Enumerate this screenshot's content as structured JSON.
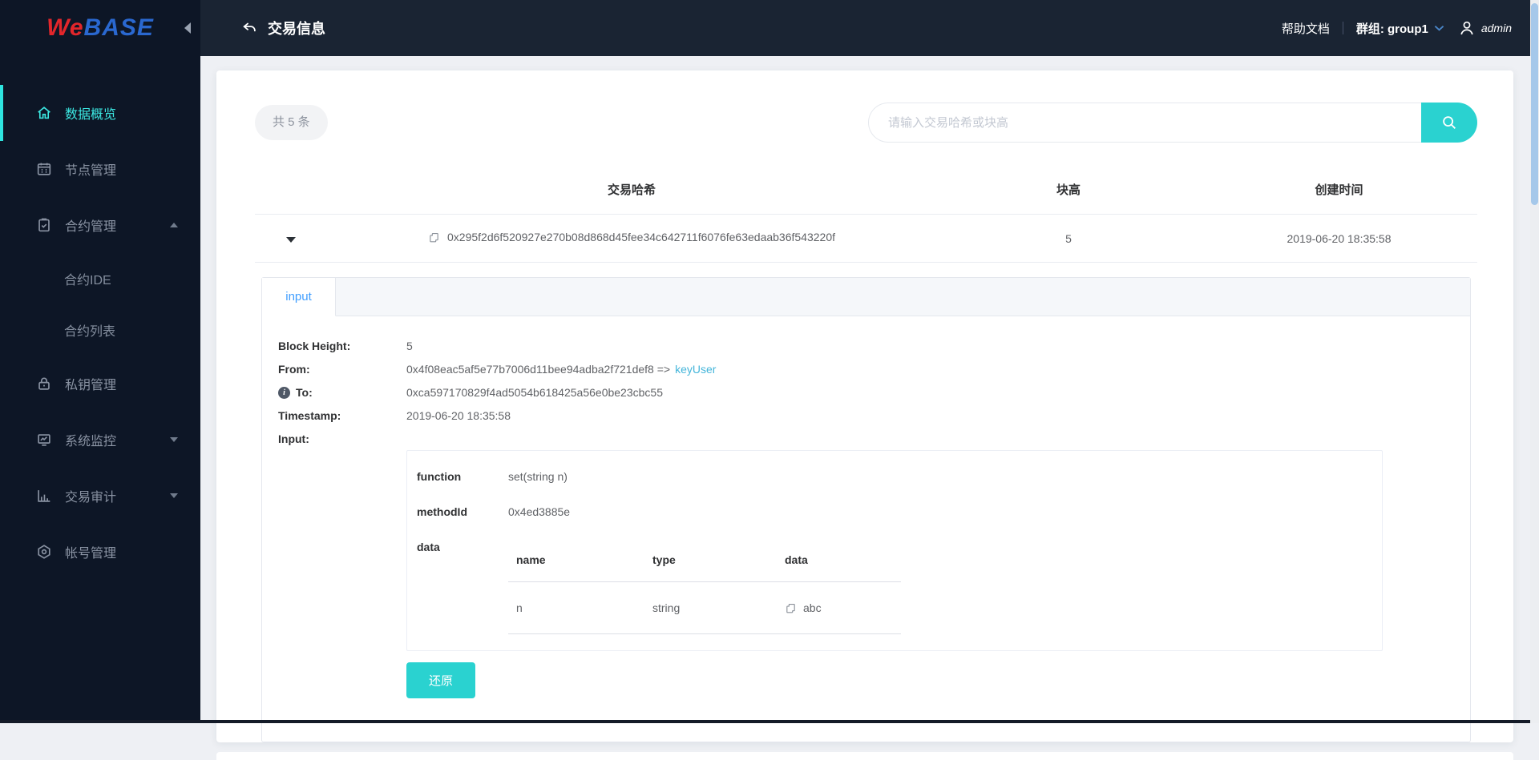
{
  "app": {
    "logo_we": "We",
    "logo_base": "BASE"
  },
  "sidebar": {
    "items": [
      {
        "label": "数据概览"
      },
      {
        "label": "节点管理"
      },
      {
        "label": "合约管理"
      },
      {
        "label": "合约IDE"
      },
      {
        "label": "合约列表"
      },
      {
        "label": "私钥管理"
      },
      {
        "label": "系统监控"
      },
      {
        "label": "交易审计"
      },
      {
        "label": "帐号管理"
      }
    ]
  },
  "header": {
    "title": "交易信息",
    "help_link": "帮助文档",
    "group": "群组: group1",
    "username": "admin"
  },
  "toolbar": {
    "total_badge": "共 5 条",
    "search_placeholder": "请输入交易哈希或块高"
  },
  "table": {
    "columns": {
      "hash": "交易哈希",
      "block": "块高",
      "created": "创建时间"
    },
    "row": {
      "hash": "0x295f2d6f520927e270b08d868d45fee34c642711f6076fe63edaab36f543220f",
      "block": "5",
      "created": "2019-06-20 18:35:58"
    }
  },
  "detail": {
    "tab_label": "input",
    "block_height_label": "Block Height:",
    "block_height": "5",
    "from_label": "From:",
    "from_address": "0x4f08eac5af5e77b7006d11bee94adba2f721def8 =>",
    "from_user": "keyUser",
    "to_label": "To:",
    "to_address": "0xca597170829f4ad5054b618425a56e0be23cbc55",
    "timestamp_label": "Timestamp:",
    "timestamp": "2019-06-20 18:35:58",
    "input_label": "Input:",
    "input_table": {
      "function_label": "function",
      "function_value": "set(string n)",
      "methodid_label": "methodId",
      "methodid_value": "0x4ed3885e",
      "data_label": "data",
      "columns": {
        "name": "name",
        "type": "type",
        "data": "data"
      },
      "row": {
        "name": "n",
        "type": "string",
        "data": "abc"
      }
    },
    "restore_button": "还原"
  },
  "colors": {
    "accent_teal": "#2ad2d0",
    "sidebar_active_teal": "#3ce8e2",
    "tab_active_blue": "#409eff",
    "link_cyan": "#44b5da",
    "logo_red": "#e2262b",
    "logo_blue": "#2a68d0",
    "sidebar_bg": "#0d1626",
    "topbar_bg": "#1a2433"
  }
}
